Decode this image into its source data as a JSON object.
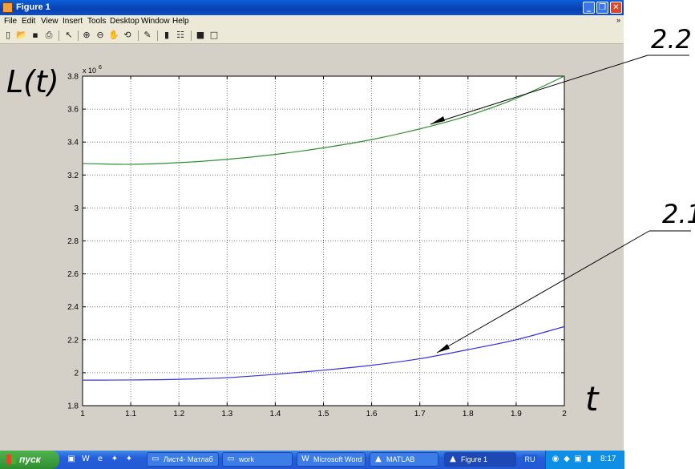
{
  "window": {
    "title": "Figure 1",
    "controls": {
      "minimize": "_",
      "maximize": "❐",
      "close": "✕"
    }
  },
  "menu": [
    "File",
    "Edit",
    "View",
    "Insert",
    "Tools",
    "Desktop",
    "Window",
    "Help"
  ],
  "toolbar": [
    {
      "name": "new-figure-icon",
      "glyph": "▯"
    },
    {
      "name": "open-file-icon",
      "glyph": "📂"
    },
    {
      "name": "save-icon",
      "glyph": "▪"
    },
    {
      "name": "print-icon",
      "glyph": "⎙"
    },
    {
      "name": "select-arrow-icon",
      "glyph": "↖"
    },
    {
      "name": "zoom-in-icon",
      "glyph": "⊕"
    },
    {
      "name": "zoom-out-icon",
      "glyph": "⊖"
    },
    {
      "name": "pan-hand-icon",
      "glyph": "✋"
    },
    {
      "name": "rotate-3d-icon",
      "glyph": "⟲"
    },
    {
      "name": "data-cursor-icon",
      "glyph": "✎"
    },
    {
      "name": "colorbar-icon",
      "glyph": "▮"
    },
    {
      "name": "legend-icon",
      "glyph": "☷"
    },
    {
      "name": "hide-plot-tools-icon",
      "glyph": "■"
    },
    {
      "name": "show-plot-tools-icon",
      "glyph": "□"
    }
  ],
  "chart_data": {
    "type": "line",
    "xlim": [
      1,
      2
    ],
    "ylim": [
      1.8,
      3.8
    ],
    "y_scale_label": "x 10",
    "y_scale_exponent": "6",
    "x_ticks": [
      1,
      1.1,
      1.2,
      1.3,
      1.4,
      1.5,
      1.6,
      1.7,
      1.8,
      1.9,
      2
    ],
    "y_ticks": [
      1.8,
      2,
      2.2,
      2.4,
      2.6,
      2.8,
      3,
      3.2,
      3.4,
      3.6,
      3.8
    ],
    "grid": true,
    "series": [
      {
        "name": "2.2",
        "color": "#2f8f2f",
        "x": [
          1,
          1.1,
          1.2,
          1.3,
          1.4,
          1.5,
          1.6,
          1.7,
          1.8,
          1.9,
          2
        ],
        "y": [
          3.27,
          3.265,
          3.275,
          3.295,
          3.325,
          3.365,
          3.415,
          3.48,
          3.56,
          3.665,
          3.8
        ]
      },
      {
        "name": "2.1",
        "color": "#3333dd",
        "x": [
          1,
          1.1,
          1.2,
          1.3,
          1.4,
          1.5,
          1.6,
          1.7,
          1.8,
          1.9,
          2
        ],
        "y": [
          1.955,
          1.956,
          1.96,
          1.97,
          1.99,
          2.015,
          2.045,
          2.085,
          2.14,
          2.2,
          2.28
        ]
      }
    ]
  },
  "annotations": {
    "y_axis_label": "L(t)",
    "x_axis_label": "t",
    "curve_labels": [
      "2.2",
      "2.1"
    ]
  },
  "taskbar": {
    "start": "пуск",
    "quicklaunch": [
      "desktop-icon",
      "word-icon",
      "ie-icon",
      "app-icon-1",
      "app-icon-2"
    ],
    "tasks": [
      {
        "name": "task-folder-matlab",
        "label": "Лист4- Матлаб",
        "glyph": "▭",
        "active": false
      },
      {
        "name": "task-folder-work",
        "label": "work",
        "glyph": "▭",
        "active": false
      },
      {
        "name": "task-word",
        "label": "Microsoft Word",
        "glyph": "W",
        "active": false
      },
      {
        "name": "task-matlab",
        "label": "MATLAB",
        "glyph": "▲",
        "active": false
      },
      {
        "name": "task-figure1",
        "label": "Figure 1",
        "glyph": "▲",
        "active": true
      }
    ],
    "lang": "RU",
    "clock": "8:17"
  }
}
